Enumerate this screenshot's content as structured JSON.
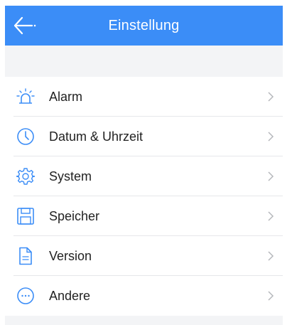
{
  "header": {
    "title": "Einstellung",
    "back_icon": "arrow-left-icon",
    "background": "#3b8df7"
  },
  "menu": {
    "items": [
      {
        "label": "Alarm",
        "icon": "alarm-light-icon"
      },
      {
        "label": "Datum & Uhrzeit",
        "icon": "clock-icon"
      },
      {
        "label": "System",
        "icon": "gear-icon"
      },
      {
        "label": "Speicher",
        "icon": "floppy-disk-icon"
      },
      {
        "label": "Version",
        "icon": "document-icon"
      },
      {
        "label": "Andere",
        "icon": "more-dots-icon"
      }
    ],
    "accent": "#3b8df7",
    "chevron": "chevron-right-icon"
  }
}
